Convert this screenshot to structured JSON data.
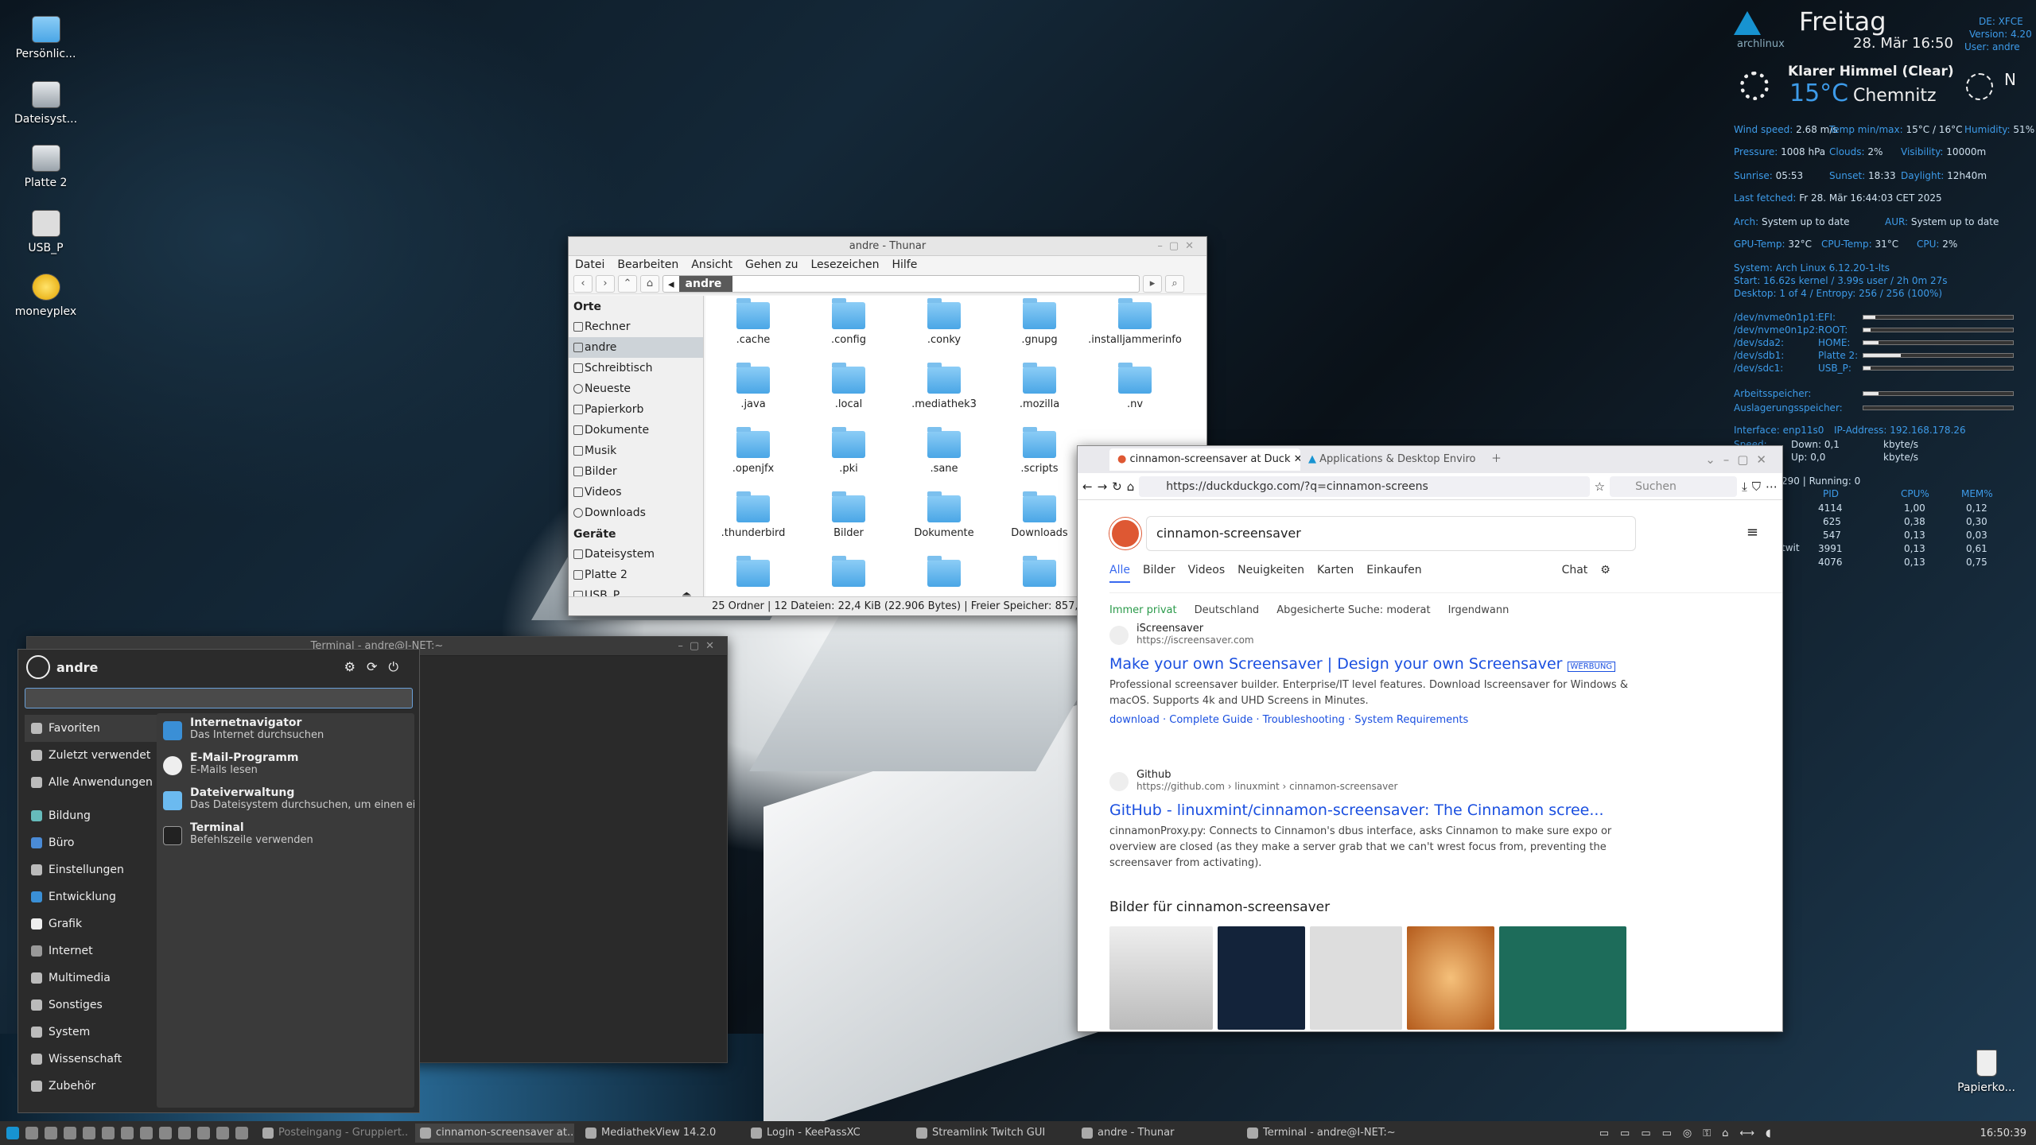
{
  "desktop": {
    "icons": [
      "Persönlic...",
      "Dateisyst...",
      "Platte 2",
      "USB_P",
      "moneyplex"
    ],
    "trash": "Papierko..."
  },
  "conky": {
    "distro": "archlinux",
    "day": "Freitag",
    "date": "28. Mär 16:50",
    "de": "DE: XFCE",
    "version": "Version: 4.20",
    "user": "User: andre",
    "weather": "Klarer Himmel (Clear)",
    "temp": "15°C",
    "city": "Chemnitz",
    "wind_dir": "N",
    "l1": "Wind speed:",
    "v1": "2.68 m/s",
    "l2": "Temp min/max:",
    "v2": "15°C / 16°C",
    "l3": "Humidity:",
    "v3": "51%",
    "l4": "Pressure:",
    "v4": "1008 hPa",
    "l5": "Clouds:",
    "v5": "2%",
    "l6": "Visibility:",
    "v6": "10000m",
    "l7": "Sunrise:",
    "v7": "05:53",
    "l8": "Sunset:",
    "v8": "18:33",
    "l9": "Daylight:",
    "v9": "12h40m",
    "l10": "Last fetched:",
    "v10": "Fr 28. Mär 16:44:03 CET 2025",
    "l11": "Arch:",
    "v11": "System up to date",
    "l12": "AUR:",
    "v12": "System up to date",
    "l13": "GPU-Temp:",
    "v13": "32°C",
    "l14": "CPU-Temp:",
    "v14": "31°C",
    "l15": "CPU:",
    "v15": "2%",
    "sys": "System: Arch Linux 6.12.20-1-lts",
    "start": "Start: 16.62s kernel / 3.99s user / 2h 0m 27s",
    "desk": "Desktop: 1 of 4   /   Entropy: 256 / 256 (100%)",
    "disks": [
      {
        "dev": "/dev/nvme0n1p1:",
        "name": "EFI:",
        "fill": 0.08
      },
      {
        "dev": "/dev/nvme0n1p2:",
        "name": "ROOT:",
        "fill": 0.05
      },
      {
        "dev": "/dev/sda2:",
        "name": "HOME:",
        "fill": 0.1
      },
      {
        "dev": "/dev/sdb1:",
        "name": "Platte 2:",
        "fill": 0.25
      },
      {
        "dev": "/dev/sdc1:",
        "name": "USB_P:",
        "fill": 0.05
      }
    ],
    "mem": "Arbeitsspeicher:",
    "mem_fill": 0.1,
    "swap": "Auslagerungsspeicher:",
    "swap_fill": 0.0,
    "iface": "Interface: enp11s0",
    "ip": "IP-Address: 192.168.178.26",
    "down": "Down: 0,1",
    "up": "Up: 0,0",
    "unit": "kbyte/s",
    "speed": "Speed:",
    "procs": "290 | Running: 0",
    "pid": "PID",
    "cpu": "CPU%",
    "memp": "MEM%",
    "plist": [
      [
        "4114",
        "1,00",
        "0,12"
      ],
      [
        "625",
        "0,38",
        "0,30"
      ],
      [
        "547",
        "0,13",
        "0,03"
      ],
      [
        "3991",
        "0,13",
        "0,61"
      ],
      [
        "4076",
        "0,13",
        "0,75"
      ]
    ],
    "twit": "twit"
  },
  "thunar": {
    "title": "andre - Thunar",
    "menu": [
      "Datei",
      "Bearbeiten",
      "Ansicht",
      "Gehen zu",
      "Lesezeichen",
      "Hilfe"
    ],
    "crumb": "andre",
    "orte": "Orte",
    "places": [
      "Rechner",
      "andre",
      "Schreibtisch",
      "Neueste",
      "Papierkorb",
      "Dokumente",
      "Musik",
      "Bilder",
      "Videos",
      "Downloads"
    ],
    "geraete": "Geräte",
    "devices": [
      "Dateisystem",
      "Platte 2",
      "USB_P"
    ],
    "files": [
      ".cache",
      ".config",
      ".conky",
      ".gnupg",
      ".installjammerinfo",
      ".java",
      ".local",
      ".mediathek3",
      ".mozilla",
      ".nv",
      ".openjfx",
      ".pki",
      ".sane",
      ".scripts",
      "",
      ".thunderbird",
      "Bilder",
      "Dokumente",
      "Downloads",
      "",
      "",
      "",
      "",
      "",
      ""
    ],
    "status": "25 Ordner  |  12 Dateien: 22,4 KiB (22.906 Bytes)  |  Freier Speicher: 857,"
  },
  "terminal": {
    "title": "Terminal - andre@I-NET:~"
  },
  "whisker": {
    "user": "andre",
    "favs": "Favoriten",
    "recent": "Zuletzt verwendet",
    "all": "Alle Anwendungen",
    "cats": [
      "Bildung",
      "Büro",
      "Einstellungen",
      "Entwicklung",
      "Grafik",
      "Internet",
      "Multimedia",
      "Sonstiges",
      "System",
      "Wissenschaft",
      "Zubehör"
    ],
    "apps": [
      {
        "n": "Internetnavigator",
        "d": "Das Internet durchsuchen"
      },
      {
        "n": "E-Mail-Programm",
        "d": "E-Mails lesen"
      },
      {
        "n": "Dateiverwaltung",
        "d": "Das Dateisystem durchsuchen, um einen ei..."
      },
      {
        "n": "Terminal",
        "d": "Befehlszeile verwenden"
      }
    ]
  },
  "browser": {
    "tab1": "cinnamon-screensaver at Duck",
    "tab2": "Applications & Desktop Enviro",
    "url": "https://duckduckgo.com/?q=cinnamon-screens",
    "search_ph": "Suchen",
    "query": "cinnamon-screensaver",
    "rtabs": [
      "Alle",
      "Bilder",
      "Videos",
      "Neuigkeiten",
      "Karten",
      "Einkaufen"
    ],
    "chat": "Chat",
    "f1": "Immer privat",
    "f2": "Deutschland",
    "f3": "Abgesicherte Suche: moderat",
    "f4": "Irgendwann",
    "r1": {
      "site": "iScreensaver",
      "url": "https://iscreensaver.com",
      "title": "Make your own Screensaver | Design your own Screensaver",
      "ad": "WERBUNG",
      "desc": "Professional screensaver builder. Enterprise/IT level features. Download Iscreensaver for Windows & macOS. Supports 4k and UHD Screens in Minutes.",
      "links": "download  ·  Complete Guide  ·  Troubleshooting  ·  System Requirements"
    },
    "r2": {
      "site": "Github",
      "url": "https://github.com › linuxmint › cinnamon-screensaver",
      "title": "GitHub - linuxmint/cinnamon-screensaver: The Cinnamon scree...",
      "desc": "cinnamonProxy.py: Connects to Cinnamon's dbus interface, asks Cinnamon to make sure expo or overview are closed (as they make a server grab that we can't wrest focus from, preventing the screensaver from activating)."
    },
    "images": "Bilder für cinnamon-screensaver"
  },
  "panel": {
    "tasks": [
      "Posteingang - Gruppiert...",
      "cinnamon-screensaver at...",
      "MediathekView 14.2.0",
      "Login - KeePassXC",
      "Streamlink Twitch GUI",
      "andre - Thunar",
      "Terminal - andre@I-NET:~"
    ],
    "clock": "16:50:39"
  }
}
